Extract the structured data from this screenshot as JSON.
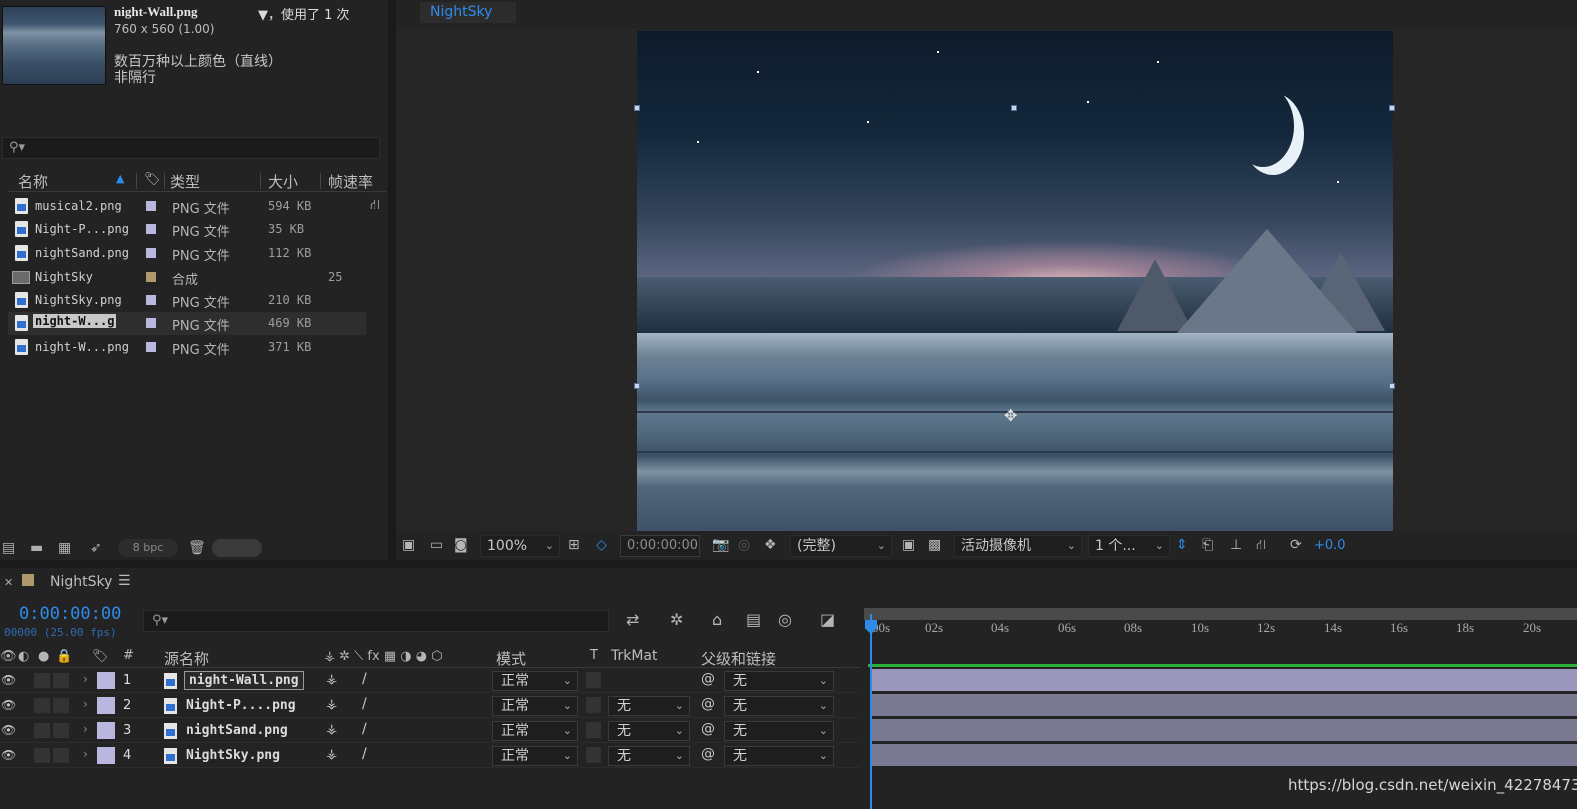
{
  "project": {
    "asset_name": "night-Wall.png",
    "asset_used": "▼，使用了 1 次",
    "asset_dims": "760 x 560 (1.00)",
    "asset_color": "数百万种以上颜色（直线）",
    "asset_interlace": "非隔行",
    "columns": {
      "name": "名称",
      "type": "类型",
      "size": "大小",
      "fps": "帧速率"
    },
    "items": [
      {
        "name": "musical2.png",
        "type": "PNG 文件",
        "size": "594 KB",
        "fps": ""
      },
      {
        "name": "Night-P...png",
        "type": "PNG 文件",
        "size": "35 KB",
        "fps": ""
      },
      {
        "name": "nightSand.png",
        "type": "PNG 文件",
        "size": "112 KB",
        "fps": ""
      },
      {
        "name": "NightSky",
        "type": "合成",
        "size": "",
        "fps": "25"
      },
      {
        "name": "NightSky.png",
        "type": "PNG 文件",
        "size": "210 KB",
        "fps": ""
      },
      {
        "name": "night-W...g",
        "type": "PNG 文件",
        "size": "469 KB",
        "fps": ""
      },
      {
        "name": "night-W...png",
        "type": "PNG 文件",
        "size": "371 KB",
        "fps": ""
      }
    ],
    "bpc": "8 bpc"
  },
  "viewer": {
    "tab": "NightSky",
    "zoom": "100%",
    "timecode": "0:00:00:00",
    "resolution": "(完整)",
    "camera": "活动摄像机",
    "views": "1 个...",
    "exposure": "+0.0"
  },
  "timeline": {
    "comp_name": "NightSky",
    "current_time": "0:00:00:00",
    "fps_readout": "00000 (25.00 fps)",
    "columns": {
      "num": "#",
      "source": "源名称",
      "mode": "模式",
      "t": "T",
      "trkmat": "TrkMat",
      "parent": "父级和链接"
    },
    "layers": [
      {
        "num": "1",
        "name": "night-Wall.png",
        "mode": "正常",
        "trkmat": "",
        "parent": "无"
      },
      {
        "num": "2",
        "name": "Night-P....png",
        "mode": "正常",
        "trkmat": "无",
        "parent": "无"
      },
      {
        "num": "3",
        "name": "nightSand.png",
        "mode": "正常",
        "trkmat": "无",
        "parent": "无"
      },
      {
        "num": "4",
        "name": "NightSky.png",
        "mode": "正常",
        "trkmat": "无",
        "parent": "无"
      }
    ],
    "ruler_ticks": [
      "00s",
      "02s",
      "04s",
      "06s",
      "08s",
      "10s",
      "12s",
      "14s",
      "16s",
      "18s",
      "20s"
    ]
  },
  "watermark": "https://blog.csdn.net/weixin_42278473",
  "colors": {
    "accent": "#2d8ceb",
    "label_lavender": "#b9b6df",
    "label_comp": "#b09a6c",
    "work_area": "#2bb23a"
  }
}
